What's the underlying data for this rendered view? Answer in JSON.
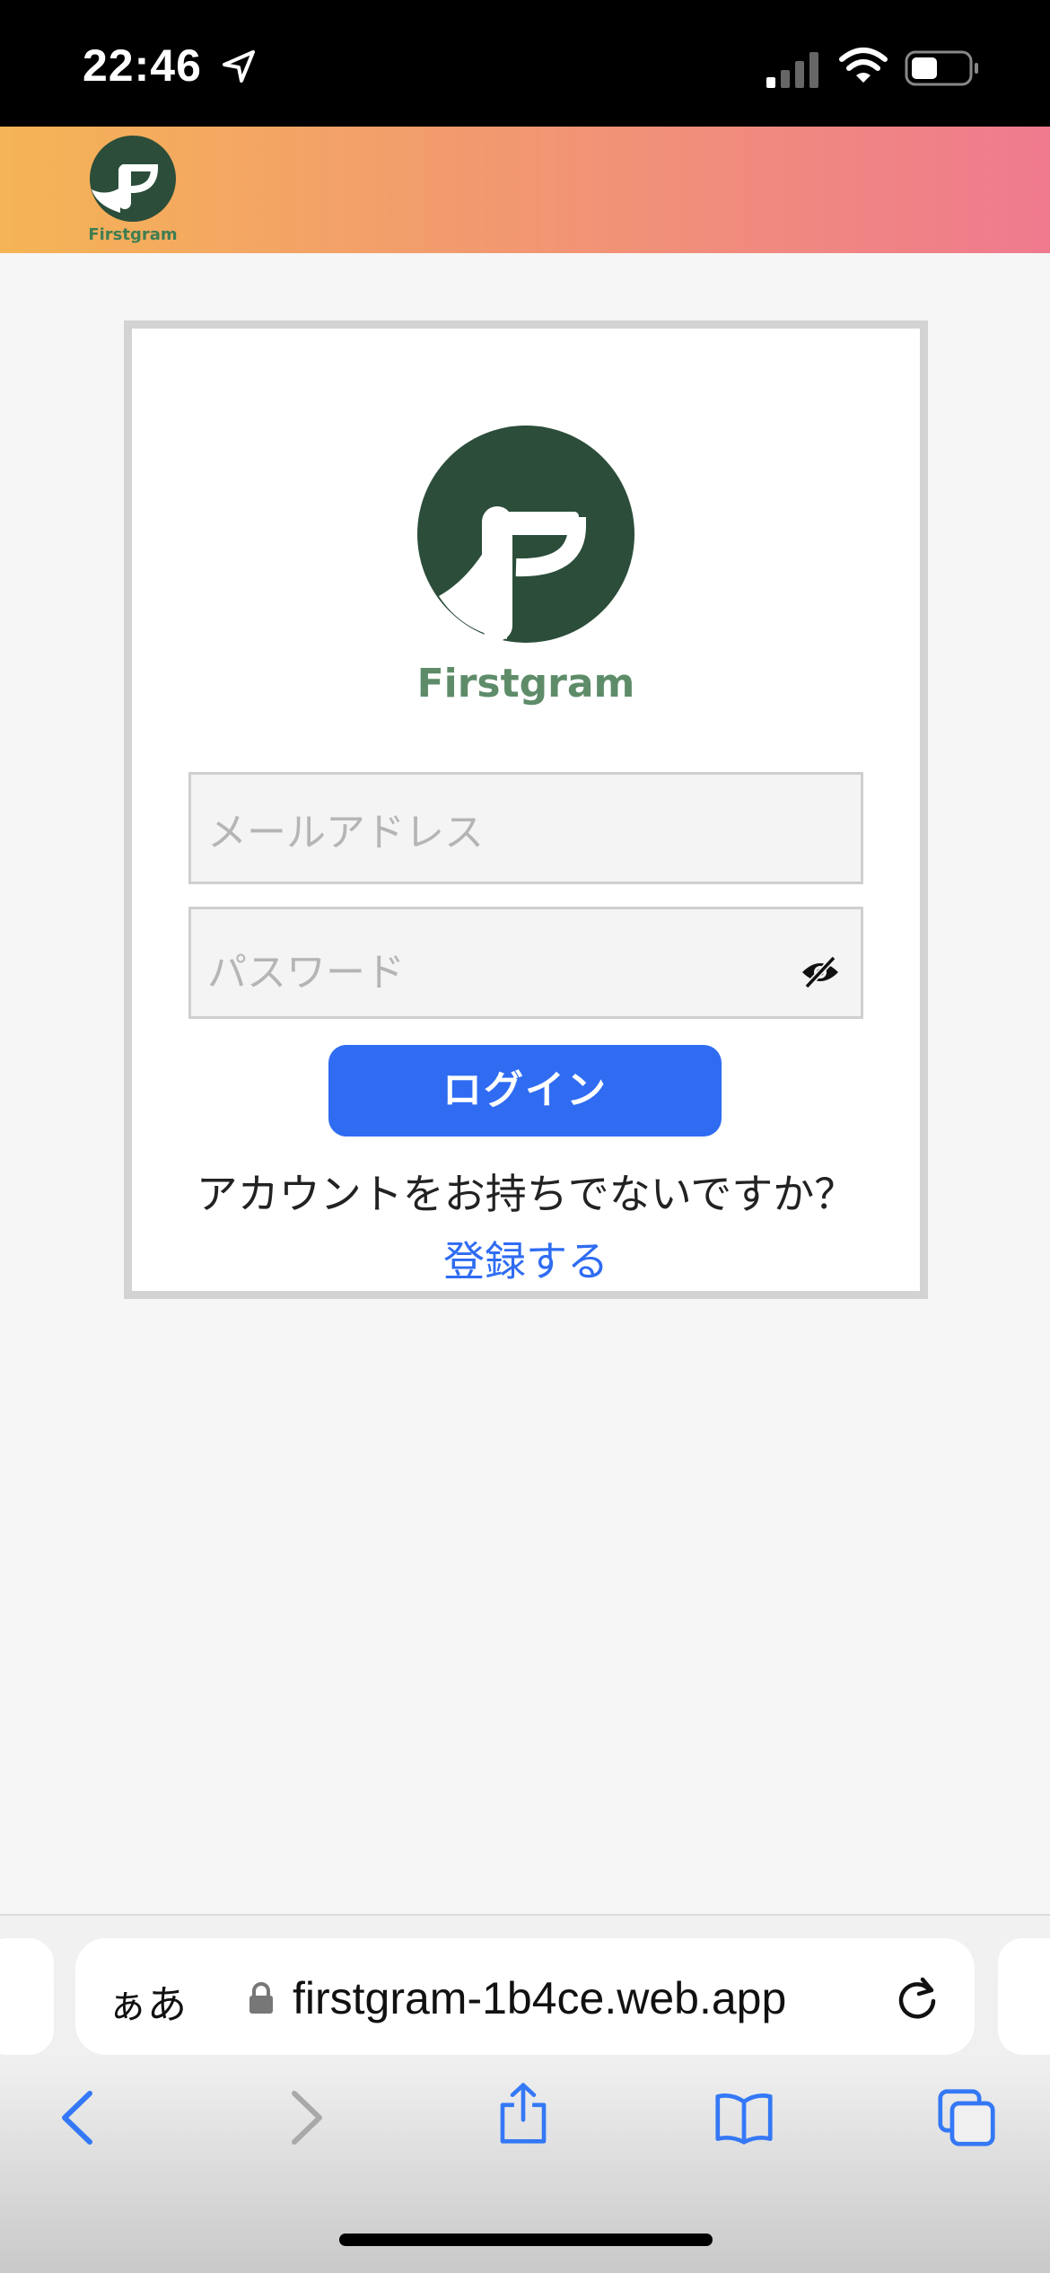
{
  "status_bar": {
    "time": "22:46"
  },
  "header": {
    "logo_text": "Firstgram"
  },
  "login": {
    "logo_text": "Firstgram",
    "email_placeholder": "メールアドレス",
    "password_placeholder": "パスワード",
    "login_button": "ログイン",
    "account_prompt": "アカウントをお持ちでないですか？",
    "register_link": "登録する"
  },
  "browser": {
    "text_size_label": "ぁあ",
    "url": "firstgram-1b4ce.web.app"
  },
  "colors": {
    "brand_green": "#2b4d3a",
    "accent_blue": "#2f6cf2",
    "header_gradient_start": "#f5b455",
    "header_gradient_end": "#ef7a8e"
  },
  "icons": [
    "location-arrow-icon",
    "signal-icon",
    "wifi-icon",
    "battery-icon",
    "eye-slash-icon",
    "lock-icon",
    "reload-icon",
    "back-icon",
    "forward-icon",
    "share-icon",
    "bookmarks-icon",
    "tabs-icon"
  ]
}
